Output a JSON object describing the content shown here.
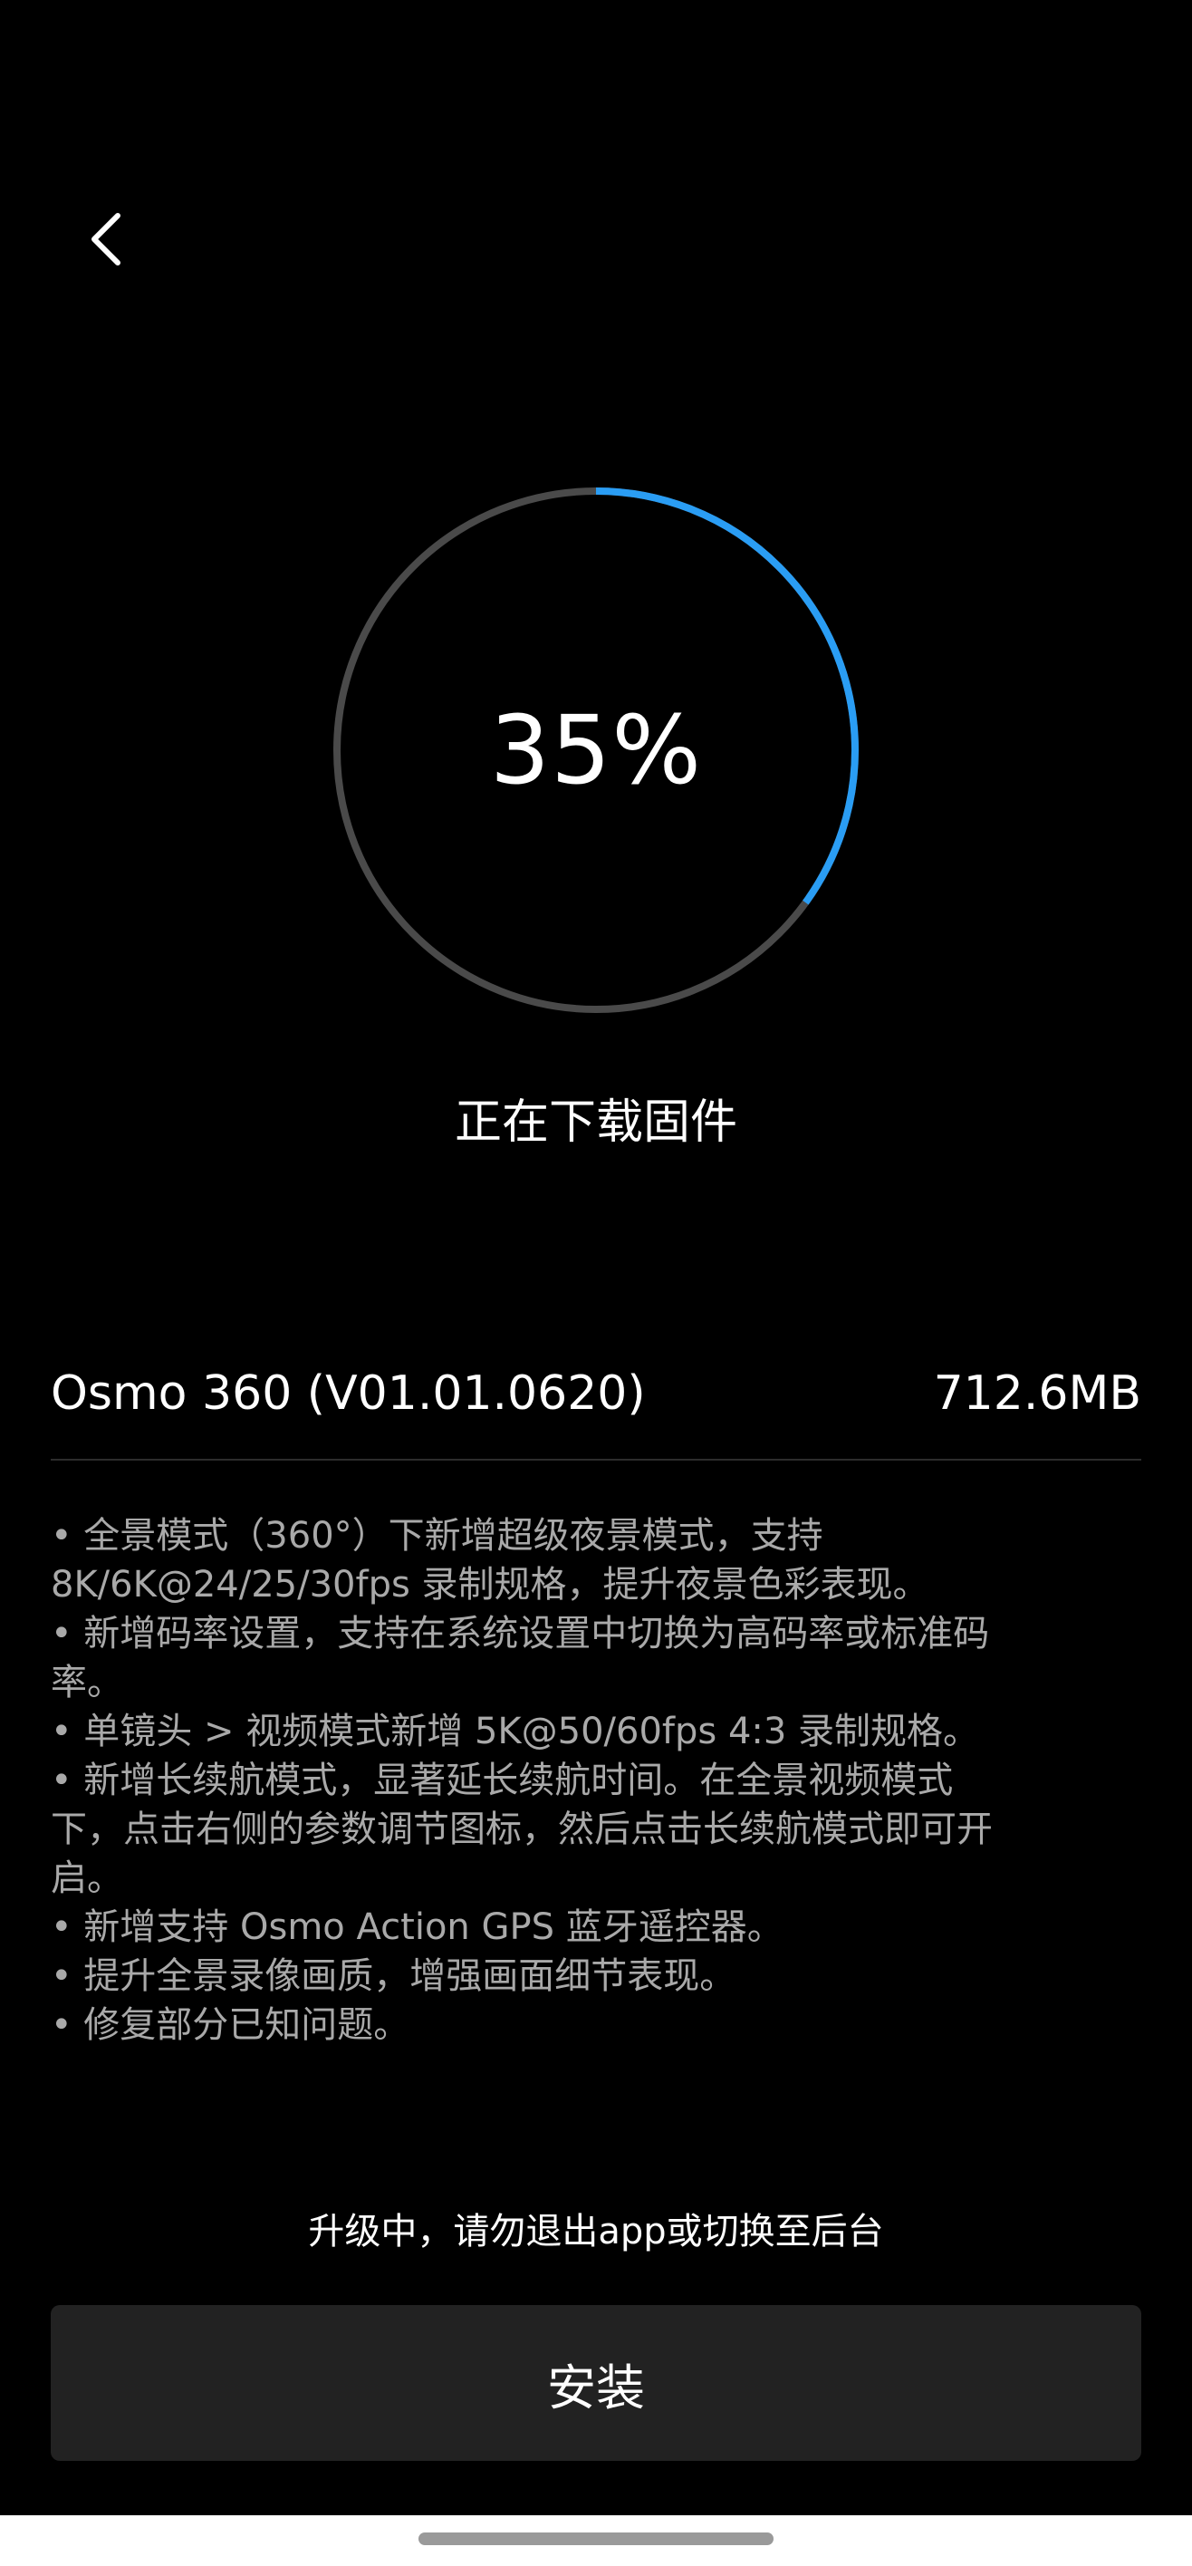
{
  "header": {
    "back_icon": "chevron-left-icon"
  },
  "progress": {
    "value": 0.35,
    "label": "35%",
    "status": "正在下载固件",
    "track_color": "#4a4a4a",
    "fill_color": "#2a9df4"
  },
  "firmware": {
    "name": "Osmo 360 (V01.01.0620)",
    "size": "712.6MB"
  },
  "release_notes": [
    "• 全景模式（360°）下新增超级夜景模式，支持",
    "8K/6K@24/25/30fps 录制规格，提升夜景色彩表现。",
    "• 新增码率设置，支持在系统设置中切换为高码率或标准码",
    "率。",
    "• 单镜头 > 视频模式新增 5K@50/60fps 4:3 录制规格。",
    "• 新增长续航模式，显著延长续航时间。在全景视频模式",
    "下，点击右侧的参数调节图标，然后点击长续航模式即可开",
    "启。",
    "• 新增支持 Osmo Action GPS 蓝牙遥控器。",
    "• 提升全景录像画质，增强画面细节表现。",
    "• 修复部分已知问题。"
  ],
  "warning": "升级中，请勿退出app或切换至后台",
  "install_button": {
    "label": "安装"
  }
}
